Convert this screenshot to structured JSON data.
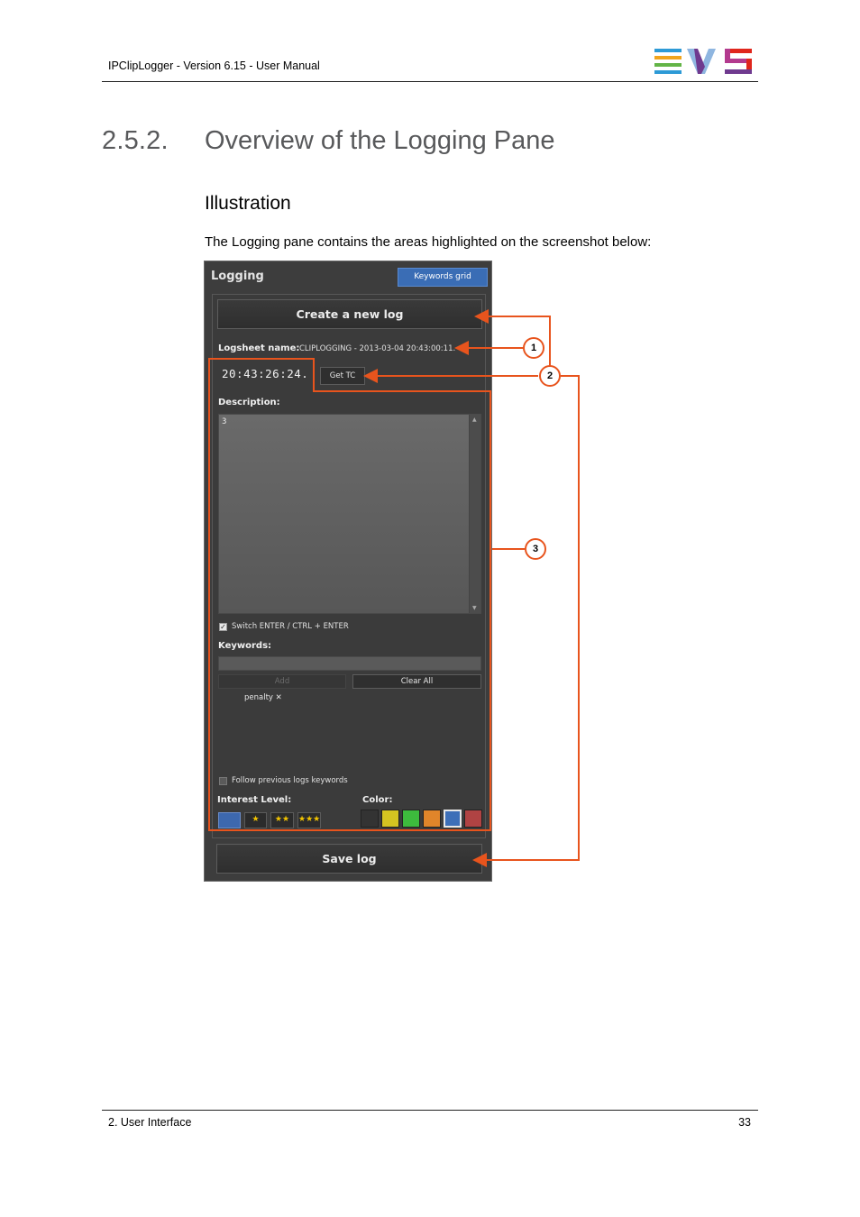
{
  "header": {
    "title": "IPClipLogger - Version 6.15 - User Manual",
    "logo_text": "EVS"
  },
  "section": {
    "number": "2.5.2.",
    "title": "Overview of the Logging Pane"
  },
  "subsection": {
    "title": "Illustration"
  },
  "intro": "The Logging pane contains the areas highlighted on the screenshot below:",
  "pane": {
    "title": "Logging",
    "keywords_grid_button": "Keywords grid",
    "create_button": "Create a new log",
    "logsheet_label": "Logsheet name:",
    "logsheet_value": "CLIPLOGGING - 2013-03-04 20:43:00:11.",
    "timecode": "20:43:26:24.",
    "get_tc_button": "Get TC",
    "description_label": "Description:",
    "description_value": "3",
    "switch_enter_label": "Switch ENTER / CTRL + ENTER",
    "keywords_label": "Keywords:",
    "keywords_input_value": "",
    "add_button": "Add",
    "clear_all_button": "Clear All",
    "keyword_tags": [
      "penalty"
    ],
    "keyword_remove_glyph": "✕",
    "follow_previous_label": "Follow previous logs keywords",
    "interest_label": "Interest Level:",
    "interest_options": [
      "",
      "★",
      "★★",
      "★★★"
    ],
    "color_label": "Color:",
    "colors": [
      "#333333",
      "#d4c421",
      "#3dbb3d",
      "#e0852a",
      "#3d6fb8",
      "#b04343"
    ],
    "selected_color_index": 4,
    "save_button": "Save log"
  },
  "callouts": [
    "1",
    "2",
    "3"
  ],
  "accent_color": "#e8541d",
  "footer": {
    "section": "2. User Interface",
    "page": "33"
  }
}
